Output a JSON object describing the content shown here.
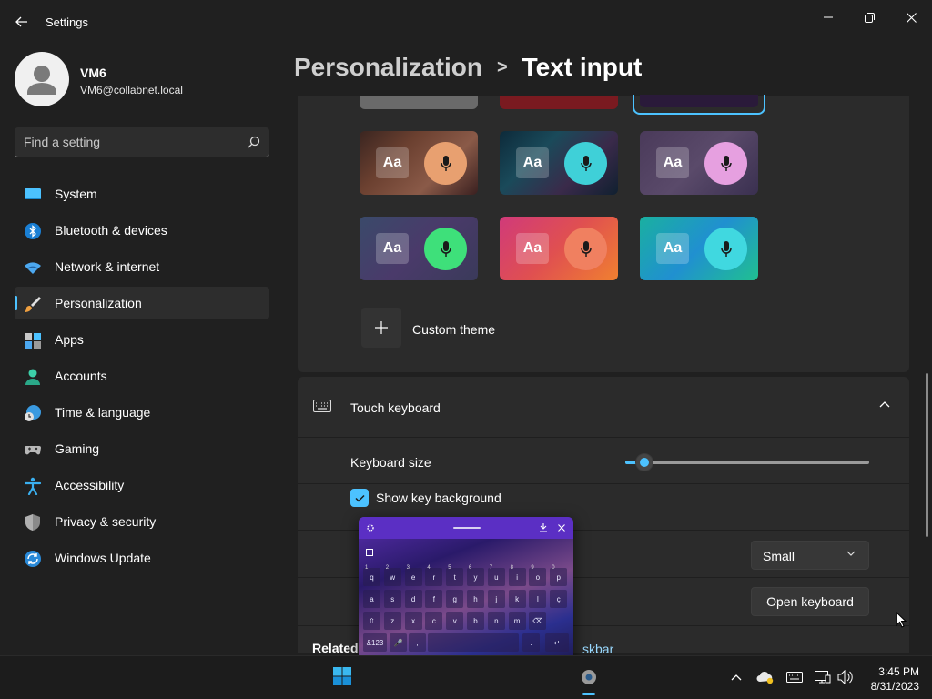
{
  "window": {
    "title": "Settings"
  },
  "profile": {
    "name": "VM6",
    "email": "VM6@collabnet.local"
  },
  "search": {
    "placeholder": "Find a setting"
  },
  "sidebar": {
    "items": [
      {
        "label": "System",
        "icon": "monitor-icon",
        "active": false
      },
      {
        "label": "Bluetooth & devices",
        "icon": "bluetooth-icon",
        "active": false
      },
      {
        "label": "Network & internet",
        "icon": "wifi-icon",
        "active": false
      },
      {
        "label": "Personalization",
        "icon": "brush-icon",
        "active": true
      },
      {
        "label": "Apps",
        "icon": "apps-icon",
        "active": false
      },
      {
        "label": "Accounts",
        "icon": "person-icon",
        "active": false
      },
      {
        "label": "Time & language",
        "icon": "globe-clock-icon",
        "active": false
      },
      {
        "label": "Gaming",
        "icon": "gamepad-icon",
        "active": false
      },
      {
        "label": "Accessibility",
        "icon": "accessibility-icon",
        "active": false
      },
      {
        "label": "Privacy & security",
        "icon": "shield-icon",
        "active": false
      },
      {
        "label": "Windows Update",
        "icon": "update-icon",
        "active": false
      }
    ]
  },
  "breadcrumb": {
    "parent": "Personalization",
    "separator": ">",
    "current": "Text input"
  },
  "themes": {
    "tile_text": "Aa",
    "custom_label": "Custom theme",
    "tiles": [
      {
        "bg": "linear-gradient(135deg,#3a2520,#6b4030,#8a5a48,#3a2020)",
        "mic_color": "#e8a070"
      },
      {
        "bg": "linear-gradient(135deg,#0d2a3a,#1a4a5a,#3a2a4a,#102030)",
        "mic_color": "#3fd0d8"
      },
      {
        "bg": "linear-gradient(135deg,#4a3a5a,#5a4a6a,#3a3050)",
        "mic_color": "#e6a0e0"
      },
      {
        "bg": "linear-gradient(135deg,#3a4a6a,#4a3a6a,#3a3a5a)",
        "mic_color": "#3ee07a"
      },
      {
        "bg": "linear-gradient(135deg,#d03a7a,#e05050,#f08030)",
        "mic_color": "#f08060"
      },
      {
        "bg": "linear-gradient(135deg,#1ab0a0,#2090d0,#20c090)",
        "mic_color": "#40d8e0"
      }
    ]
  },
  "touch_keyboard": {
    "title": "Touch keyboard",
    "keyboard_size_label": "Keyboard size",
    "keyboard_size_value": 0.08,
    "show_key_background_label": "Show key background",
    "show_key_background_checked": true,
    "dropdown_value": "Small",
    "open_keyboard_label": "Open keyboard"
  },
  "related": {
    "label": "Related",
    "link_text": "skbar"
  },
  "keyboard_popup": {
    "rows": [
      [
        "q",
        "w",
        "e",
        "r",
        "t",
        "y",
        "u",
        "i",
        "o",
        "p"
      ],
      [
        "a",
        "s",
        "d",
        "f",
        "g",
        "h",
        "j",
        "k",
        "l",
        "ç"
      ],
      [
        "⇧",
        "z",
        "x",
        "c",
        "v",
        "b",
        "n",
        "m",
        "⌫"
      ],
      [
        "&123",
        "🎤",
        ",",
        "",
        ".",
        "↵"
      ]
    ],
    "numbers": [
      "1",
      "2",
      "3",
      "4",
      "5",
      "6",
      "7",
      "8",
      "9",
      "0"
    ]
  },
  "taskbar": {
    "time": "3:45 PM",
    "date": "8/31/2023"
  },
  "colors": {
    "accent": "#4cc2ff",
    "background": "#202020",
    "card": "#2b2b2b"
  }
}
